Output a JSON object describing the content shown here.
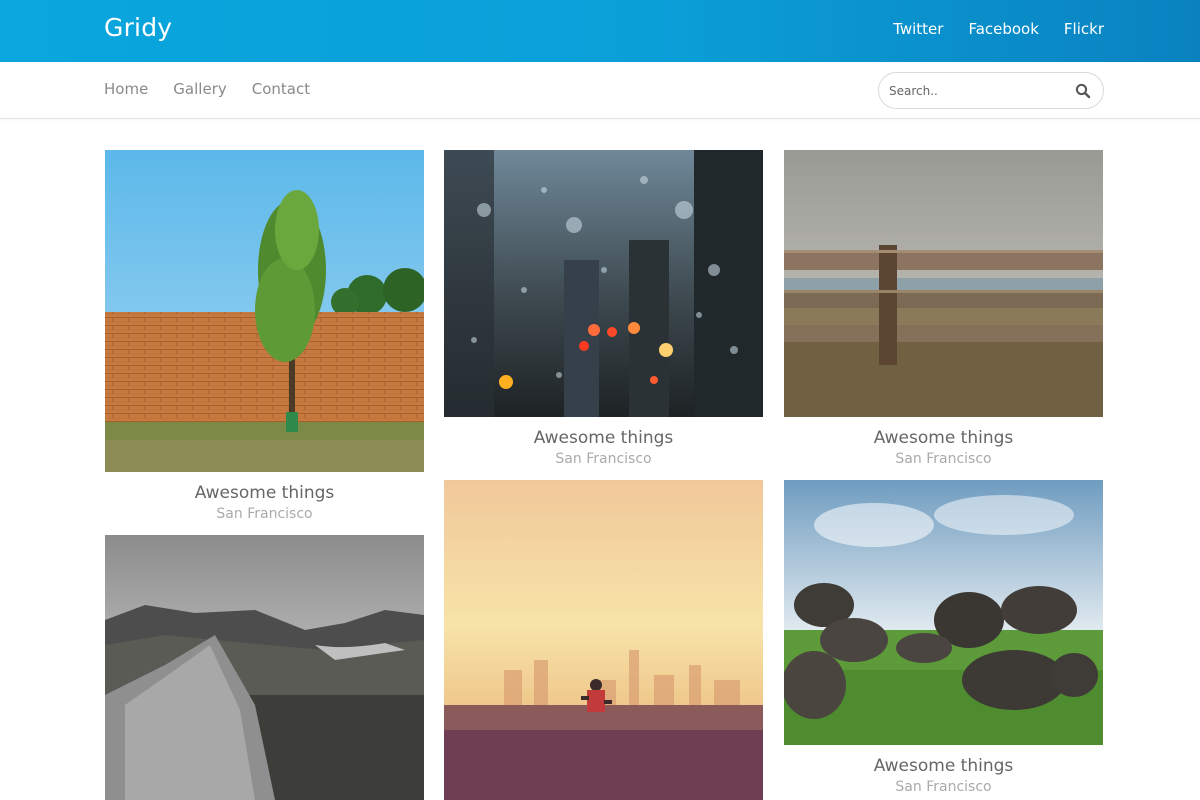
{
  "header": {
    "brand": "Gridy",
    "social": [
      "Twitter",
      "Facebook",
      "Flickr"
    ]
  },
  "nav": {
    "items": [
      "Home",
      "Gallery",
      "Contact"
    ],
    "search_placeholder": "Search..",
    "search_icon": "search-icon"
  },
  "colors": {
    "topbar_start": "#0aa6dd",
    "topbar_end": "#0a82c0",
    "link_gray": "#8a8a8a"
  },
  "gallery": [
    {
      "scene": "tree-brick-wall",
      "title": "Awesome things",
      "location": "San Francisco"
    },
    {
      "scene": "rainy-window-city",
      "title": "Awesome things",
      "location": "San Francisco"
    },
    {
      "scene": "wooden-fence",
      "title": "Awesome things",
      "location": "San Francisco"
    },
    {
      "scene": "mountain-rock",
      "title": "",
      "location": ""
    },
    {
      "scene": "sunset-runner",
      "title": "",
      "location": ""
    },
    {
      "scene": "stone-dolmen",
      "title": "Awesome things",
      "location": "San Francisco"
    }
  ]
}
